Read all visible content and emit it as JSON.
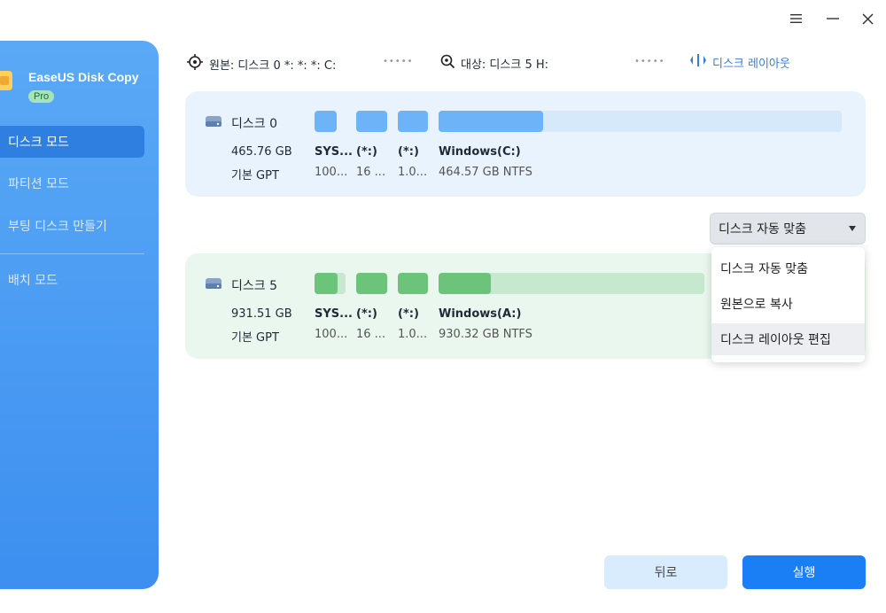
{
  "app": {
    "name": "EaseUS Disk Copy",
    "badge": "Pro"
  },
  "sidebar": {
    "items": [
      {
        "label": "디스크 모드",
        "active": true
      },
      {
        "label": "파티션 모드",
        "active": false
      },
      {
        "label": "부팅 디스크 만들기",
        "active": false
      },
      {
        "label": "배치 모드",
        "active": false
      }
    ]
  },
  "topbar": {
    "source": "원본: 디스크 0 *: *: *: C:",
    "target": "대상: 디스크 5 H:",
    "layout": "디스크 레이아웃",
    "dots": "•••••"
  },
  "source_disk": {
    "name": "디스크 0",
    "size": "465.76 GB",
    "type": "기본 GPT",
    "partitions": [
      {
        "label": "SYS...",
        "detail": "100..."
      },
      {
        "label": "(*:)",
        "detail": "16 ..."
      },
      {
        "label": "(*:)",
        "detail": "1.0..."
      },
      {
        "label": "Windows(C:)",
        "detail": "464.57 GB NTFS"
      }
    ]
  },
  "target_disk": {
    "name": "디스크 5",
    "size": "931.51 GB",
    "type": "기본 GPT",
    "partitions": [
      {
        "label": "SYS...",
        "detail": "100..."
      },
      {
        "label": "(*:)",
        "detail": "16 ..."
      },
      {
        "label": "(*:)",
        "detail": "1.0..."
      },
      {
        "label": "Windows(A:)",
        "detail": "930.32 GB NTFS"
      }
    ]
  },
  "dropdown": {
    "selected": "디스크 자동 맞춤",
    "options": [
      "디스크 자동 맞춤",
      "원본으로 복사",
      "디스크 레이아웃 편집"
    ]
  },
  "buttons": {
    "back": "뒤로",
    "run": "실행"
  },
  "colors": {
    "accent": "#1a7ff5",
    "source_partition": "#6db3f8",
    "target_partition": "#6cc47b",
    "source_bg": "#e9f3fd",
    "target_bg": "#e9f7ee"
  }
}
